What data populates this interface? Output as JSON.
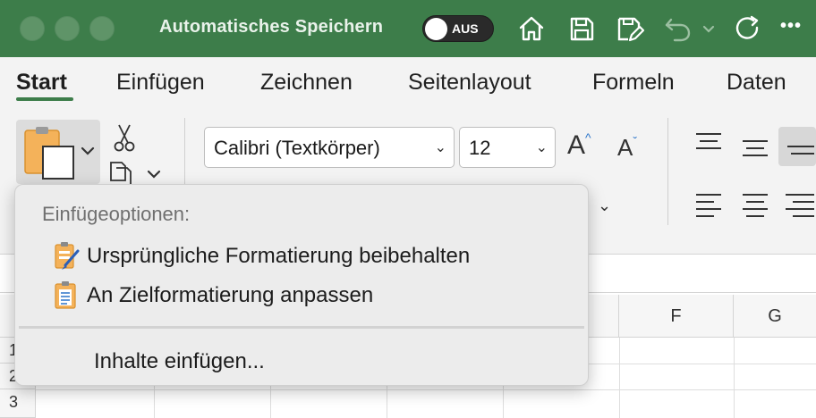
{
  "titlebar": {
    "autosave_label": "Automatisches Speichern",
    "autosave_toggle": "AUS",
    "more": "•••"
  },
  "tabs": [
    {
      "label": "Start",
      "active": true
    },
    {
      "label": "Einfügen"
    },
    {
      "label": "Zeichnen"
    },
    {
      "label": "Seitenlayout"
    },
    {
      "label": "Formeln"
    },
    {
      "label": "Daten"
    }
  ],
  "ribbon": {
    "font_name": "Calibri (Textkörper)",
    "font_size": "12",
    "grow_font": "A",
    "shrink_font": "A"
  },
  "columns": [
    "F",
    "G"
  ],
  "rows": [
    "1",
    "2",
    "3"
  ],
  "paste_menu": {
    "header": "Einfügeoptionen:",
    "items": [
      {
        "label": "Ursprüngliche Formatierung beibehalten",
        "icon": "paste-keep-formatting-icon"
      },
      {
        "label": "An Zielformatierung anpassen",
        "icon": "paste-match-destination-icon"
      }
    ],
    "special": "Inhalte einfügen..."
  },
  "colors": {
    "titlebar": "#3d7d4a",
    "accent": "#3d7d4a",
    "clipboard": "#f0a040"
  }
}
